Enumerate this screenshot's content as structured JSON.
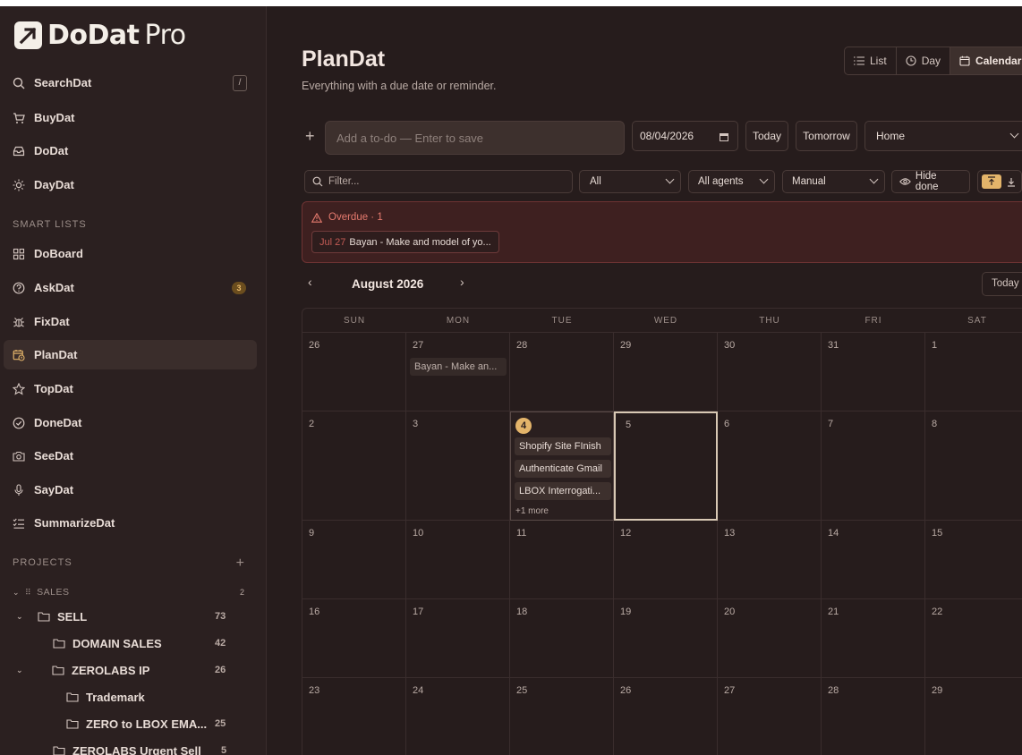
{
  "app": {
    "logo_main": "DoDat",
    "logo_pro": "Pro"
  },
  "sidebar": {
    "search": {
      "label": "SearchDat",
      "shortcut": "/"
    },
    "items": [
      {
        "label": "BuyDat",
        "icon": "cart-icon"
      },
      {
        "label": "DoDat",
        "icon": "inbox-icon"
      },
      {
        "label": "DayDat",
        "icon": "sun-icon"
      }
    ],
    "smart_lists_label": "SMART LISTS",
    "smart_lists": [
      {
        "label": "DoBoard",
        "icon": "grid-icon"
      },
      {
        "label": "AskDat",
        "icon": "question-icon",
        "badge": "3"
      },
      {
        "label": "FixDat",
        "icon": "bug-icon"
      },
      {
        "label": "PlanDat",
        "icon": "calendar-clock-icon",
        "active": true
      },
      {
        "label": "TopDat",
        "icon": "star-icon"
      },
      {
        "label": "DoneDat",
        "icon": "check-circle-icon"
      },
      {
        "label": "SeeDat",
        "icon": "camera-icon"
      },
      {
        "label": "SayDat",
        "icon": "mic-icon"
      },
      {
        "label": "SummarizeDat",
        "icon": "list-check-icon"
      }
    ],
    "projects_label": "PROJECTS",
    "projects_add": "+",
    "tree": {
      "sales_group": {
        "label": "SALES",
        "count": "2"
      },
      "sell": {
        "label": "SELL",
        "count": "73"
      },
      "domain_sales": {
        "label": "DOMAIN SALES",
        "count": "42"
      },
      "zerolabs_ip": {
        "label": "ZEROLABS IP",
        "count": "26"
      },
      "trademark": {
        "label": "Trademark",
        "count": ""
      },
      "zero_lbox": {
        "label": "ZERO to LBOX EMA...",
        "count": "25"
      },
      "zerolabs_urgent": {
        "label": "ZEROLABS Urgent Sell",
        "count": "5"
      }
    }
  },
  "main": {
    "title": "PlanDat",
    "subtitle": "Everything with a due date or reminder.",
    "views": {
      "list": "List",
      "day": "Day",
      "calendar": "Calendar"
    },
    "add": {
      "plus": "+",
      "placeholder": "Add a to-do — Enter to save",
      "date": "08/04/2026",
      "today": "Today",
      "tomorrow": "Tomorrow",
      "project": "Home"
    },
    "filters": {
      "filter_placeholder": "Filter...",
      "status": "All",
      "agents": "All agents",
      "sort": "Manual",
      "hide_done": "Hide done"
    },
    "overdue": {
      "title": "Overdue · 1",
      "chip_date": "Jul 27",
      "chip_text": "Bayan - Make and model of yo..."
    },
    "calendar": {
      "month": "August 2026",
      "today_label": "Today",
      "weekdays": [
        "SUN",
        "MON",
        "TUE",
        "WED",
        "THU",
        "FRI",
        "SAT"
      ],
      "weeks": [
        [
          "26",
          "27",
          "28",
          "29",
          "30",
          "31",
          "1"
        ],
        [
          "2",
          "3",
          "4",
          "5",
          "6",
          "7",
          "8"
        ],
        [
          "9",
          "10",
          "11",
          "12",
          "13",
          "14",
          "15"
        ],
        [
          "16",
          "17",
          "18",
          "19",
          "20",
          "21",
          "22"
        ],
        [
          "23",
          "24",
          "25",
          "26",
          "27",
          "28",
          "29"
        ]
      ],
      "events": {
        "jul27": "Bayan - Make an...",
        "aug4": [
          "Shopify Site FInish",
          "Authenticate Gmail",
          "LBOX Interrogati..."
        ],
        "aug4_more": "+1 more"
      }
    }
  },
  "colors": {
    "background": "#261c1c",
    "sidebar": "#2b2020",
    "accent": "#e3b46a",
    "overdue": "#e57a6e"
  }
}
